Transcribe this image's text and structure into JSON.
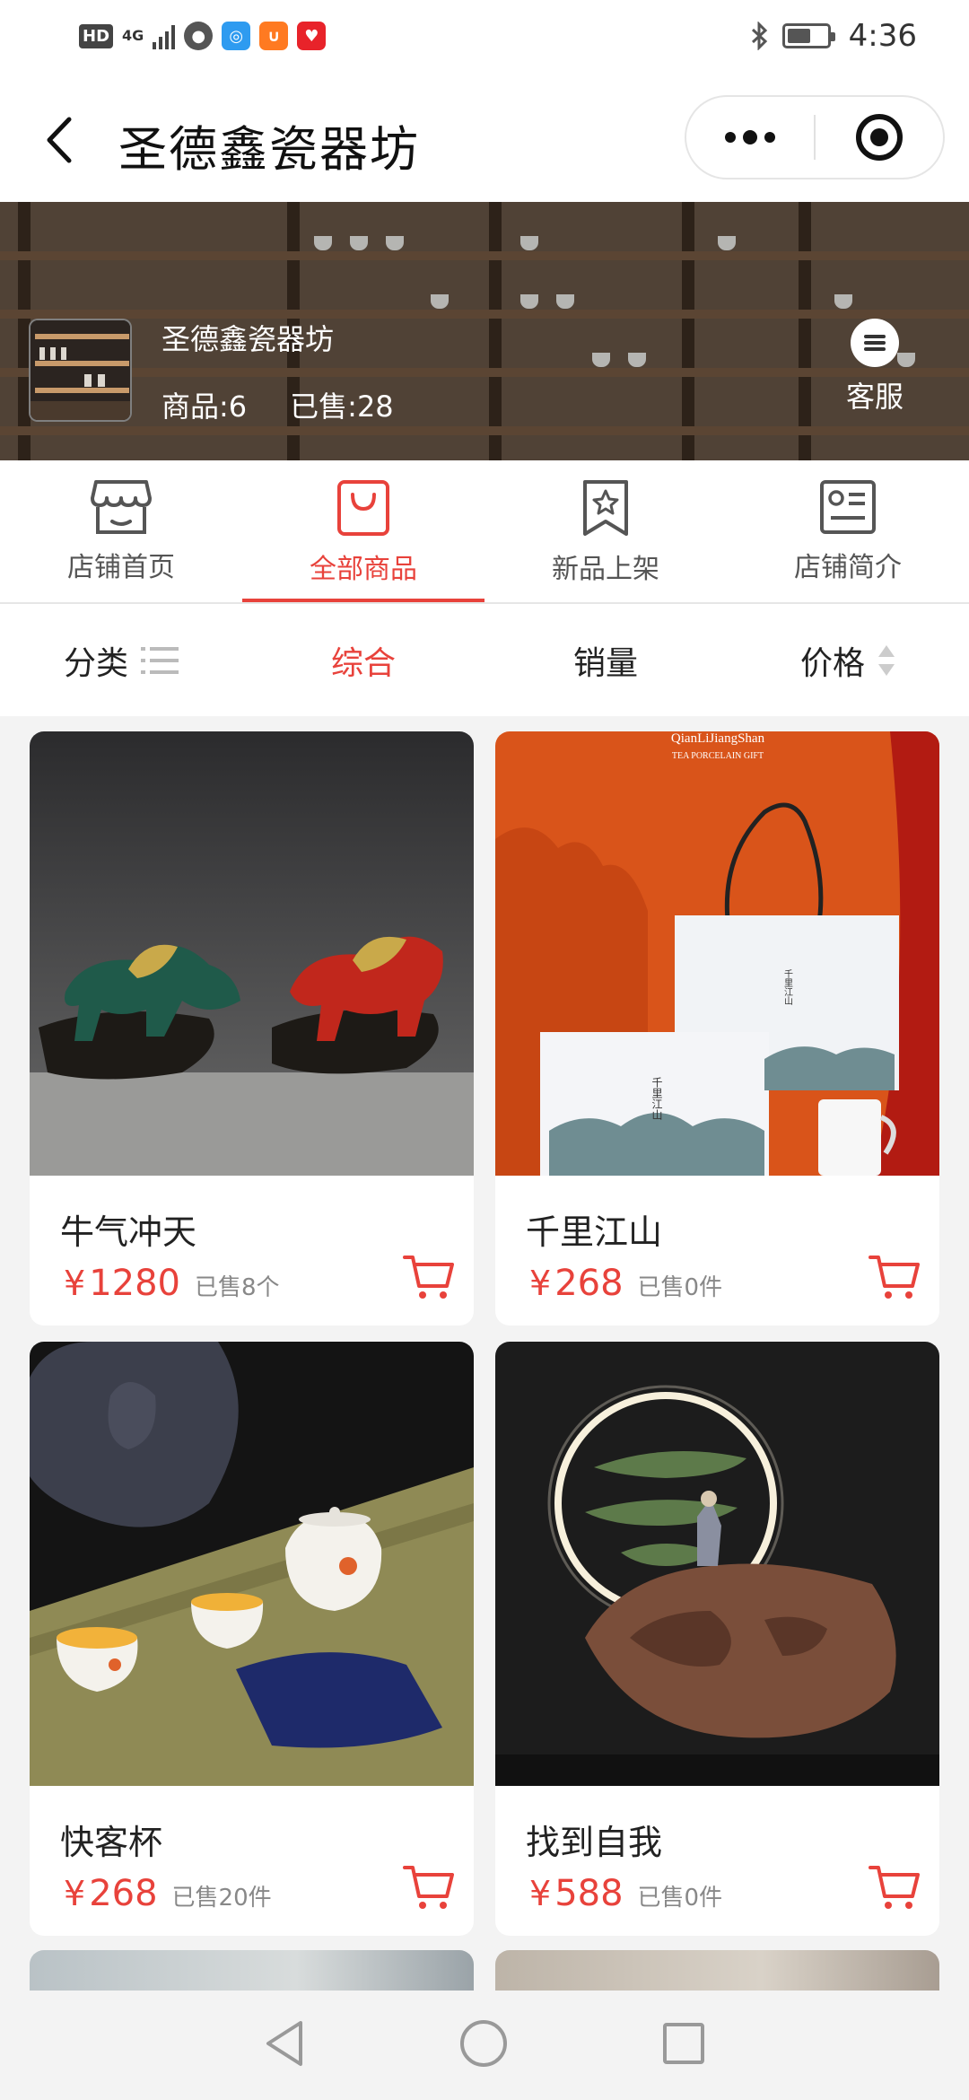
{
  "status_bar": {
    "hd": "HD",
    "network": "4G",
    "time": "4:36",
    "battery_level": 0.6
  },
  "nav": {
    "title": "圣德鑫瓷器坊",
    "more_icon": "more-dots-icon",
    "target_icon": "close-target-icon"
  },
  "shop": {
    "name": "圣德鑫瓷器坊",
    "products": "商品:6",
    "sold": "已售:28",
    "service_label": "客服"
  },
  "tabs": [
    {
      "label": "店铺首页",
      "icon": "storefront-icon",
      "active": false
    },
    {
      "label": "全部商品",
      "icon": "shopping-bag-icon",
      "active": true
    },
    {
      "label": "新品上架",
      "icon": "bookmark-star-icon",
      "active": false
    },
    {
      "label": "店铺简介",
      "icon": "profile-card-icon",
      "active": false
    }
  ],
  "sort": {
    "category": "分类",
    "overall": "综合",
    "sales": "销量",
    "price": "价格"
  },
  "products": [
    {
      "name": "牛气冲天",
      "currency": "¥",
      "price": "1280",
      "sold": "已售8个"
    },
    {
      "name": "千里江山",
      "currency": "¥",
      "price": "268",
      "sold": "已售0件"
    },
    {
      "name": "快客杯",
      "currency": "¥",
      "price": "268",
      "sold": "已售20件"
    },
    {
      "name": "找到自我",
      "currency": "¥",
      "price": "588",
      "sold": "已售0件"
    }
  ],
  "image_text": {
    "brand_line1": "QianLiJiangShan",
    "brand_line2": "TEA PORCELAIN GIFT",
    "box_text": "千里江山"
  },
  "colors": {
    "accent": "#e8423b",
    "text": "#222222",
    "muted": "#888888"
  }
}
